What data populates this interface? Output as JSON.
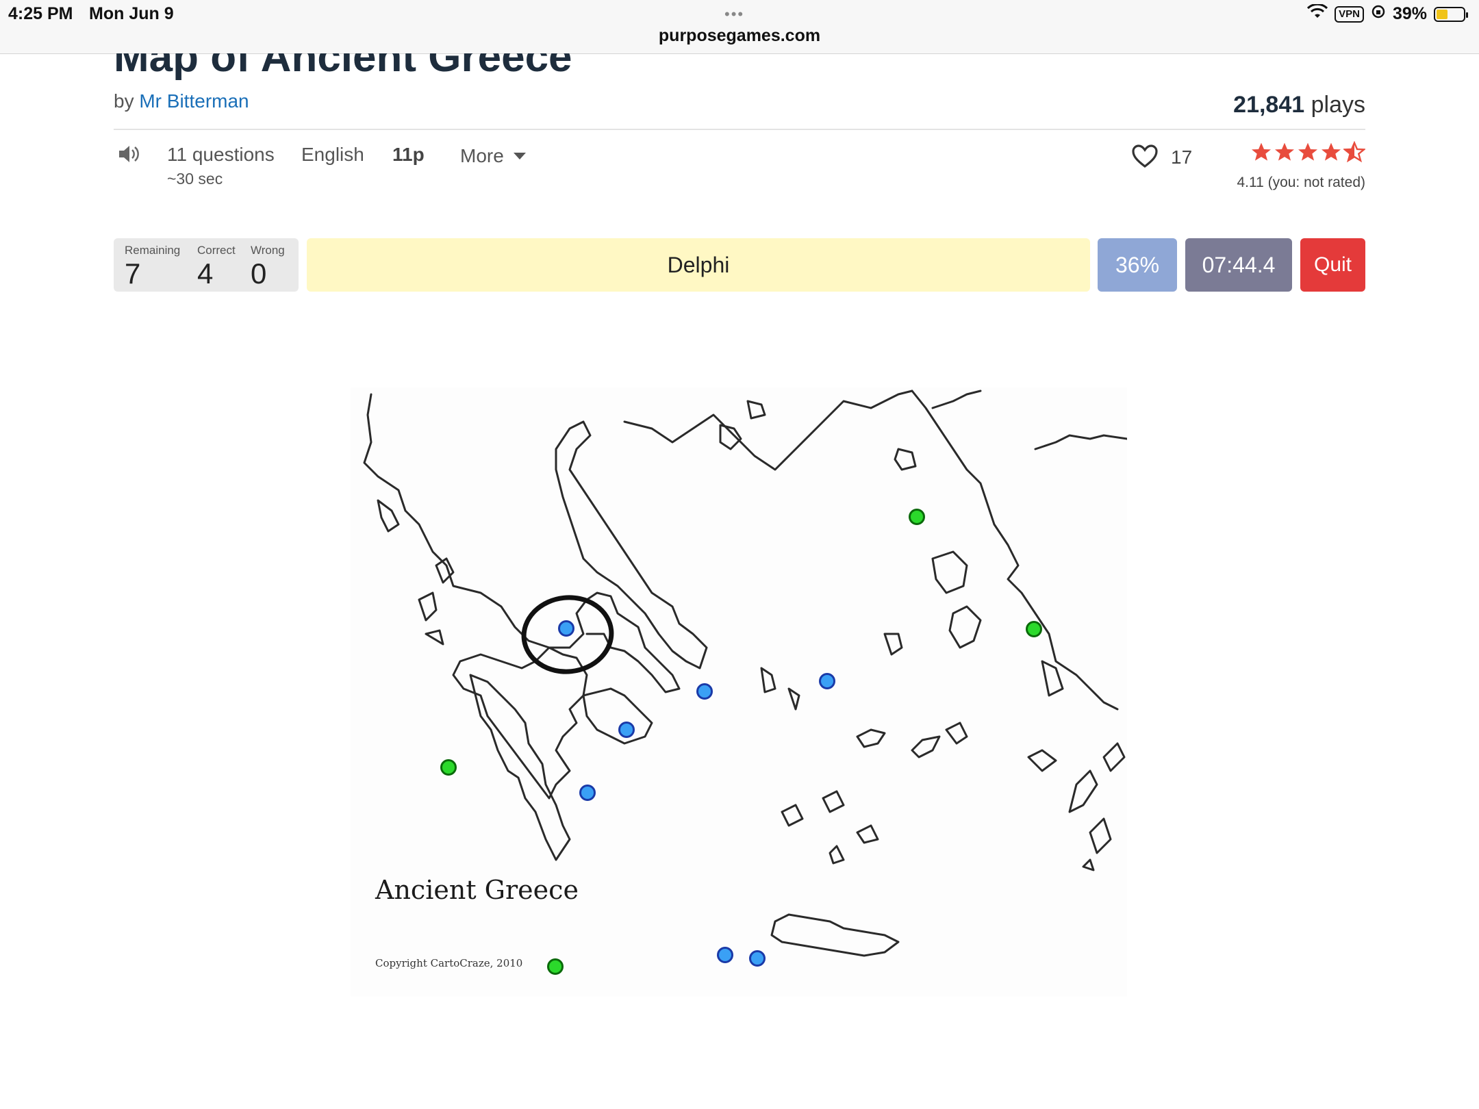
{
  "status_bar": {
    "time": "4:25 PM",
    "date": "Mon Jun 9",
    "dots": "•••",
    "url": "purposegames.com",
    "vpn": "VPN",
    "battery": "39%"
  },
  "header": {
    "title": "Map of Ancient Greece",
    "by_prefix": "by",
    "author": "Mr Bitterman",
    "plays_count": "21,841",
    "plays_label": "plays"
  },
  "meta": {
    "questions": "11 questions",
    "duration": "~30 sec",
    "language": "English",
    "points": "11p",
    "more": "More",
    "likes": "17",
    "rating_text": "4.11 (you: not rated)",
    "rating_value": 4.11
  },
  "game": {
    "remaining_label": "Remaining",
    "remaining": "7",
    "correct_label": "Correct",
    "correct": "4",
    "wrong_label": "Wrong",
    "wrong": "0",
    "question": "Delphi",
    "progress": "36%",
    "timer": "07:44.4",
    "quit": "Quit"
  },
  "map": {
    "title": "Ancient Greece",
    "copyright": "Copyright CartoCraze, 2010",
    "colors": {
      "unanswered": "#3aa0f5",
      "answered": "#2bd92b"
    }
  }
}
